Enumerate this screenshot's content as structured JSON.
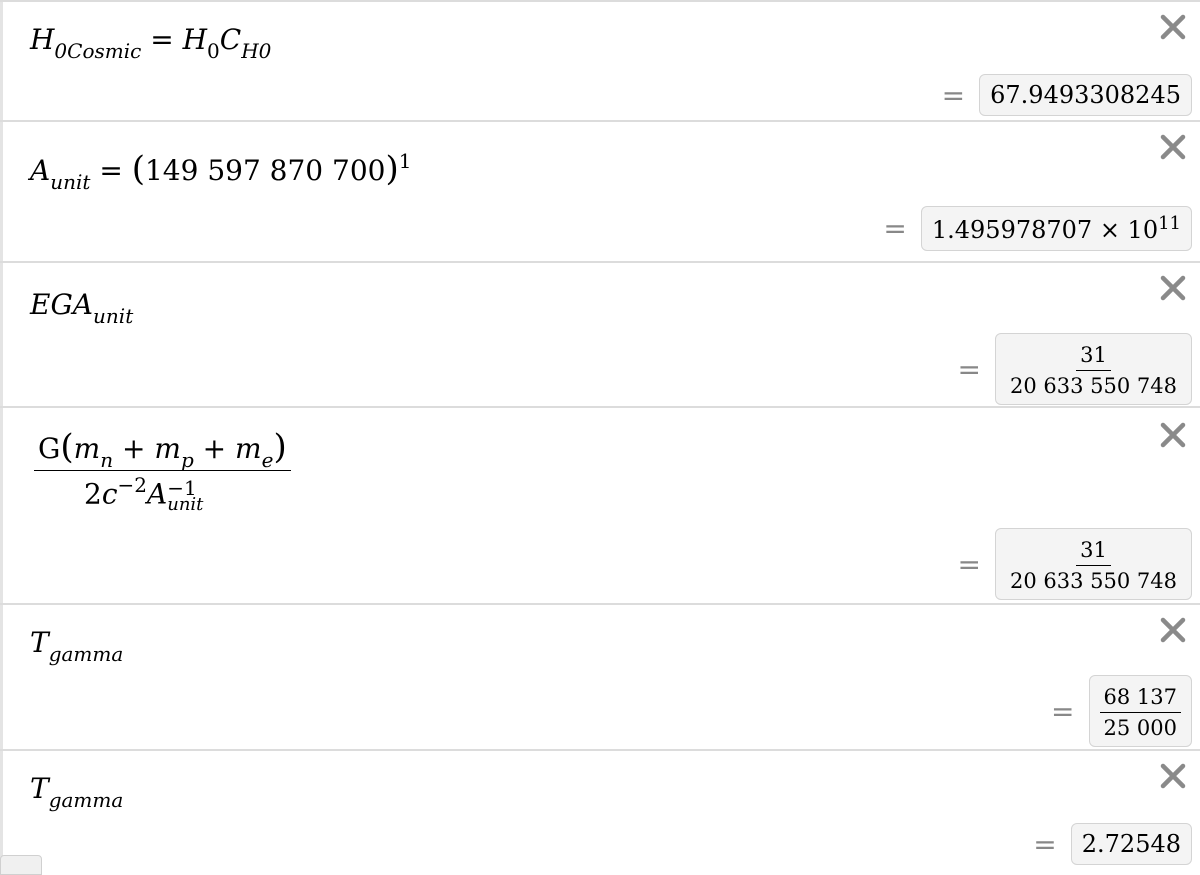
{
  "expressions": [
    {
      "id": "h0cosmic",
      "latex_text": "H_{0Cosmic}=H_0C_{H0}",
      "parts": {
        "lhs_base": "H",
        "lhs_sub": "0Cosmic",
        "eq": "=",
        "r1_base": "H",
        "r1_sub": "0",
        "r2_base": "C",
        "r2_sub": "H0"
      },
      "result": {
        "eq": "=",
        "value": "67.9493308245"
      }
    },
    {
      "id": "aunit",
      "parts": {
        "lhs_base": "A",
        "lhs_sub": "unit",
        "eq": "=",
        "lparen": "(",
        "number": "149 597 870 700",
        "rparen": ")",
        "exp": "1"
      },
      "result": {
        "eq": "=",
        "mantissa": "1.495978707 × 10",
        "exp": "11"
      }
    },
    {
      "id": "egaunit",
      "parts": {
        "base": "EGA",
        "sub": "unit"
      },
      "result": {
        "eq": "=",
        "num": "31",
        "den": "20 633 550 748"
      }
    },
    {
      "id": "gravity-fraction",
      "parts": {
        "G": "G",
        "lparen": "(",
        "m1": "m",
        "m1_sub": "n",
        "plus1": "+",
        "m2": "m",
        "m2_sub": "p",
        "plus2": "+",
        "m3": "m",
        "m3_sub": "e",
        "rparen": ")",
        "den_coef": "2",
        "den_c": "c",
        "den_c_exp": "−2",
        "den_a": "A",
        "den_a_exp": "−1",
        "den_a_sub": "unit"
      },
      "result": {
        "eq": "=",
        "num": "31",
        "den": "20 633 550 748"
      }
    },
    {
      "id": "tgamma-fraction",
      "parts": {
        "base": "T",
        "sub": "gamma"
      },
      "result": {
        "eq": "=",
        "num": "68 137",
        "den": "25 000"
      }
    },
    {
      "id": "tgamma-decimal",
      "parts": {
        "base": "T",
        "sub": "gamma"
      },
      "result": {
        "eq": "=",
        "value": "2.72548"
      }
    }
  ],
  "icons": {
    "delete": "close-x-icon"
  },
  "colors": {
    "divider": "#dcdcdc",
    "result_bg": "#f4f4f4",
    "equals_sign": "#888888"
  }
}
